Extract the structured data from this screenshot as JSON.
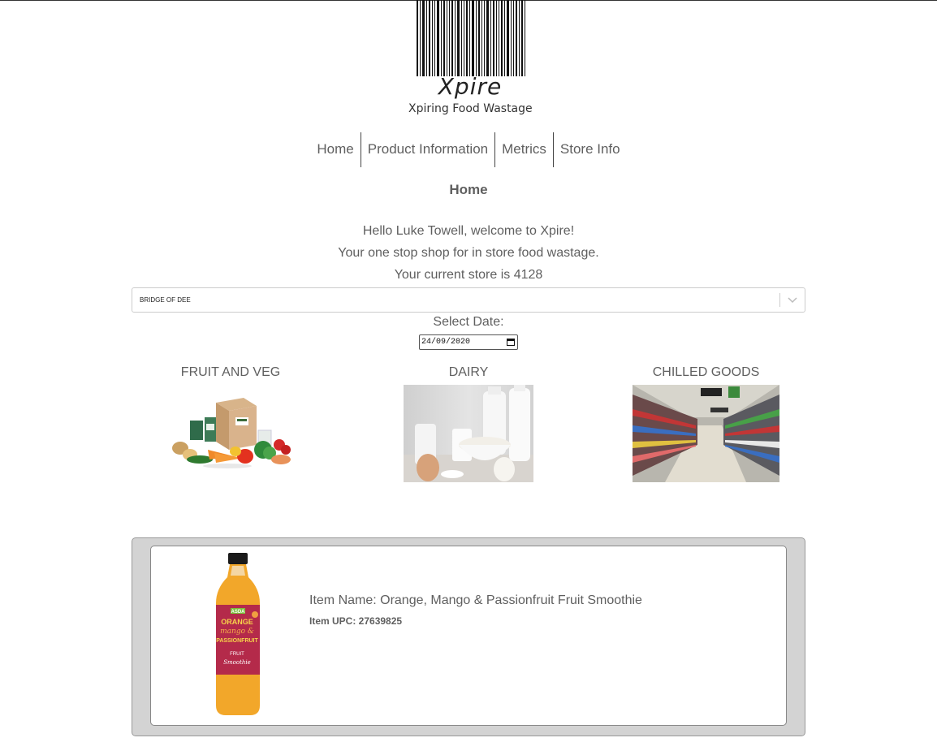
{
  "logo": {
    "name": "Xpire",
    "tagline": "Xpiring Food Wastage"
  },
  "nav": {
    "items": [
      {
        "label": "Home"
      },
      {
        "label": "Product Information"
      },
      {
        "label": "Metrics"
      },
      {
        "label": "Store Info"
      }
    ]
  },
  "page": {
    "title": "Home",
    "greeting": "Hello Luke Towell, welcome to Xpire!",
    "tagline": "Your one stop shop for in store food wastage.",
    "current_store": "Your current store is 4128"
  },
  "store_select": {
    "value": "BRIDGE OF DEE",
    "icon": "chevron-down-icon"
  },
  "date": {
    "label": "Select Date:",
    "value": "24/09/2020",
    "icon": "calendar-icon"
  },
  "categories": [
    {
      "label": "FRUIT AND VEG"
    },
    {
      "label": "DAIRY"
    },
    {
      "label": "CHILLED GOODS"
    }
  ],
  "product": {
    "name": "Item Name: Orange, Mango & Passionfruit Fruit Smoothie",
    "upc": "Item UPC: 27639825",
    "bottle_text": [
      "ASDA",
      "ORANGE",
      "mango &",
      "PASSIONFRUIT",
      "FRUIT",
      "Smoothie"
    ]
  },
  "colors": {
    "text": "#5f5f5f",
    "panel_bg": "#d3d3d3",
    "card_bg": "#ffffff"
  }
}
